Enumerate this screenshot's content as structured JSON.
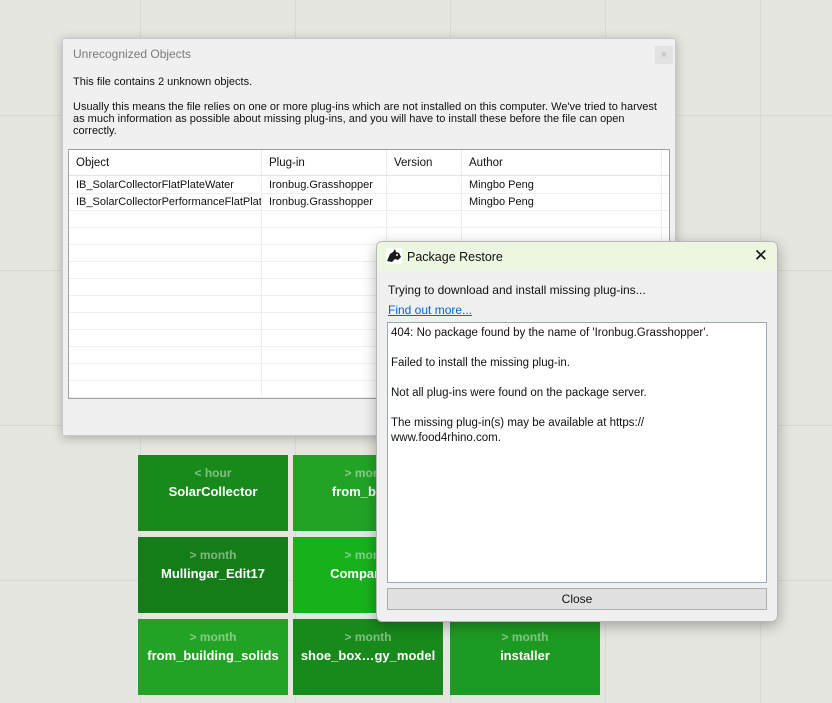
{
  "tiles": [
    {
      "tag": "< hour",
      "name": "SolarCollector",
      "color": "#178a1b"
    },
    {
      "tag": "> month",
      "name": "from_buil…",
      "color": "#23a326"
    },
    {
      "tag": "> month",
      "name": "Mullingar_Edit17",
      "color": "#157d18"
    },
    {
      "tag": "> month",
      "name": "Comparison",
      "color": "#17b11c"
    },
    {
      "tag": "> month",
      "name": "from_building_solids",
      "color": "#23a326"
    },
    {
      "tag": "> month",
      "name": "shoe_box…gy_model",
      "color": "#178a1b"
    },
    {
      "tag": "> month",
      "name": "installer",
      "color": "#1d9a22"
    }
  ],
  "unrecognized": {
    "title": "Unrecognized Objects",
    "close_glyph": "×",
    "summary": "This file contains 2 unknown objects.",
    "details": "Usually this means the file relies on one or more plug-ins which are not installed on this computer. We've tried to harvest as much information as possible about missing plug-ins, and you will have to install these before the file can open correctly.",
    "columns": [
      "Object",
      "Plug-in",
      "Version",
      "Author"
    ],
    "rows": [
      [
        "IB_SolarCollectorFlatPlateWater",
        "Ironbug.Grasshopper",
        "",
        "Mingbo Peng"
      ],
      [
        "IB_SolarCollectorPerformanceFlatPlate",
        "Ironbug.Grasshopper",
        "",
        "Mingbo Peng"
      ]
    ]
  },
  "package_restore": {
    "title": "Package Restore",
    "icon": "rhino-icon",
    "close_glyph": "✕",
    "message": "Trying to download and install missing plug-ins...",
    "link": "Find out more...",
    "log": [
      "404: No package found by the name of 'Ironbug.Grasshopper'.",
      "",
      "Failed to install the missing plug-in.",
      "",
      "Not all plug-ins were found on the package server.",
      "",
      "The missing plug-in(s) may be available at https://\nwww.food4rhino.com."
    ],
    "close_label": "Close"
  }
}
